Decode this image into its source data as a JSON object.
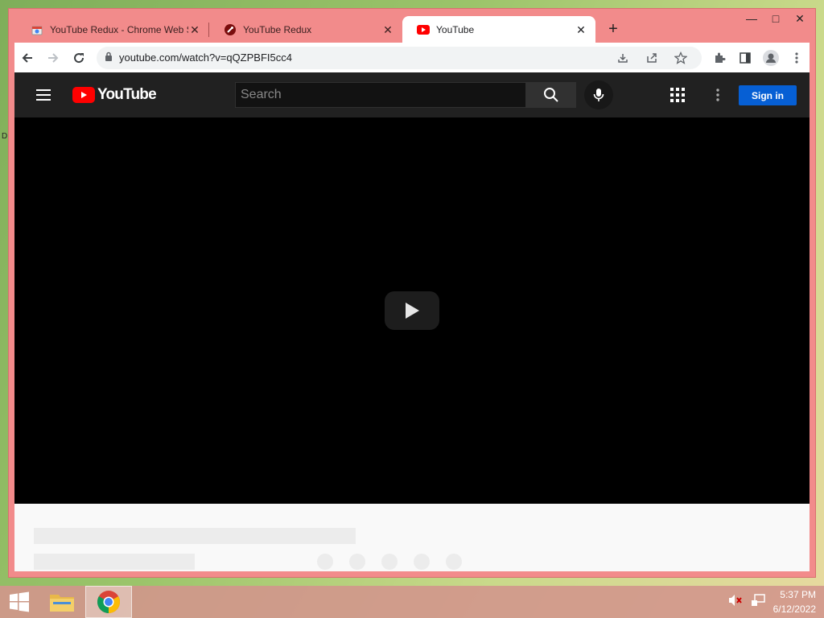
{
  "browser": {
    "tabs": [
      {
        "title": "YouTube Redux - Chrome Web Store",
        "active": false
      },
      {
        "title": "YouTube Redux",
        "active": false
      },
      {
        "title": "YouTube",
        "active": true
      }
    ],
    "new_tab": "+",
    "url": "youtube.com/watch?v=qQZPBFI5cc4"
  },
  "youtube": {
    "logo_text": "YouTube",
    "search_placeholder": "Search",
    "signin_label": "Sign in"
  },
  "side_marker": "D",
  "taskbar": {
    "time": "5:37 PM",
    "date": "6/12/2022"
  },
  "colors": {
    "frame": "#f28b8b",
    "yt_red": "#ff0000",
    "signin_blue": "#065fd4"
  }
}
